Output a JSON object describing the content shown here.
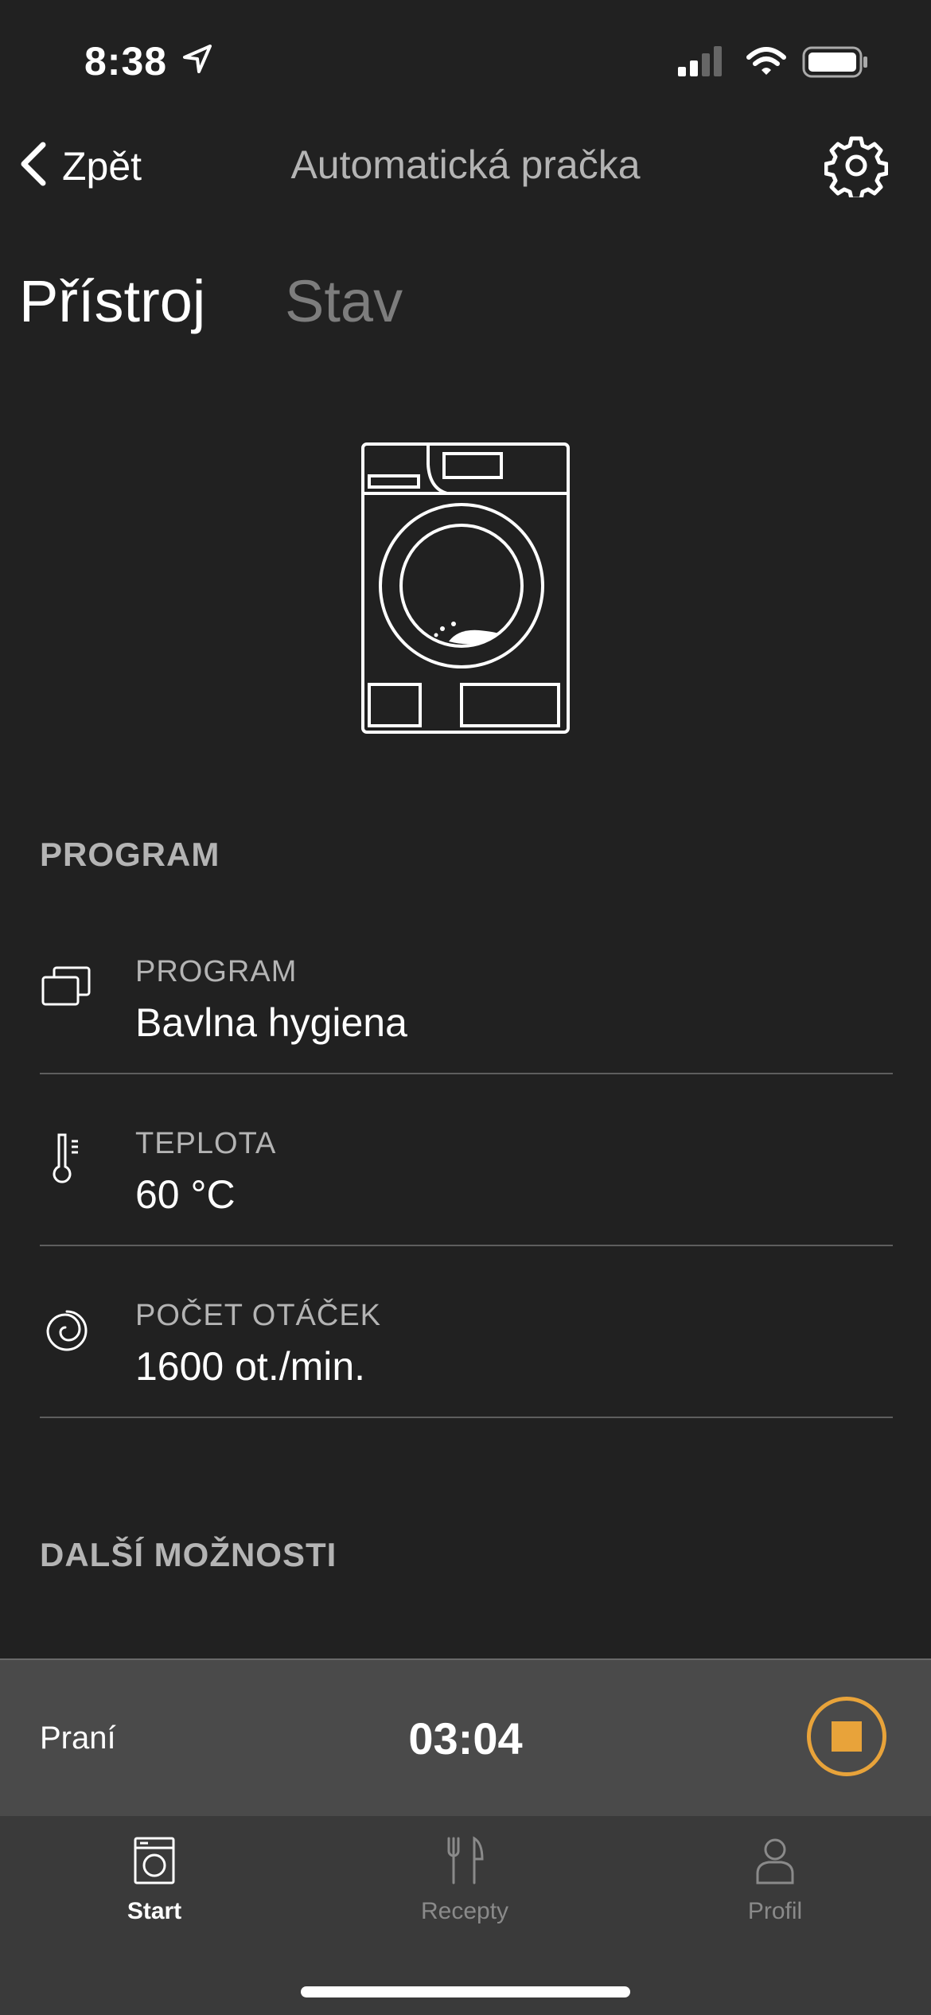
{
  "status_bar": {
    "time": "8:38"
  },
  "nav": {
    "back_label": "Zpět",
    "title": "Automatická pračka"
  },
  "tabs": [
    {
      "label": "Přístroj",
      "active": true
    },
    {
      "label": "Stav",
      "active": false
    }
  ],
  "program_section": {
    "title": "PROGRAM",
    "rows": [
      {
        "icon": "layers-icon",
        "label": "PROGRAM",
        "value": "Bavlna hygiena"
      },
      {
        "icon": "thermometer-icon",
        "label": "TEPLOTA",
        "value": "60 °C"
      },
      {
        "icon": "spin-icon",
        "label": "POČET OTÁČEK",
        "value": "1600 ot./min."
      }
    ]
  },
  "more_section": {
    "title": "DALŠÍ MOŽNOSTI"
  },
  "player": {
    "label": "Praní",
    "time": "03:04",
    "accent": "#e8a33a"
  },
  "tabbar": [
    {
      "label": "Start",
      "icon": "washer-icon",
      "active": true
    },
    {
      "label": "Recepty",
      "icon": "cutlery-icon",
      "active": false
    },
    {
      "label": "Profil",
      "icon": "profile-icon",
      "active": false
    }
  ]
}
